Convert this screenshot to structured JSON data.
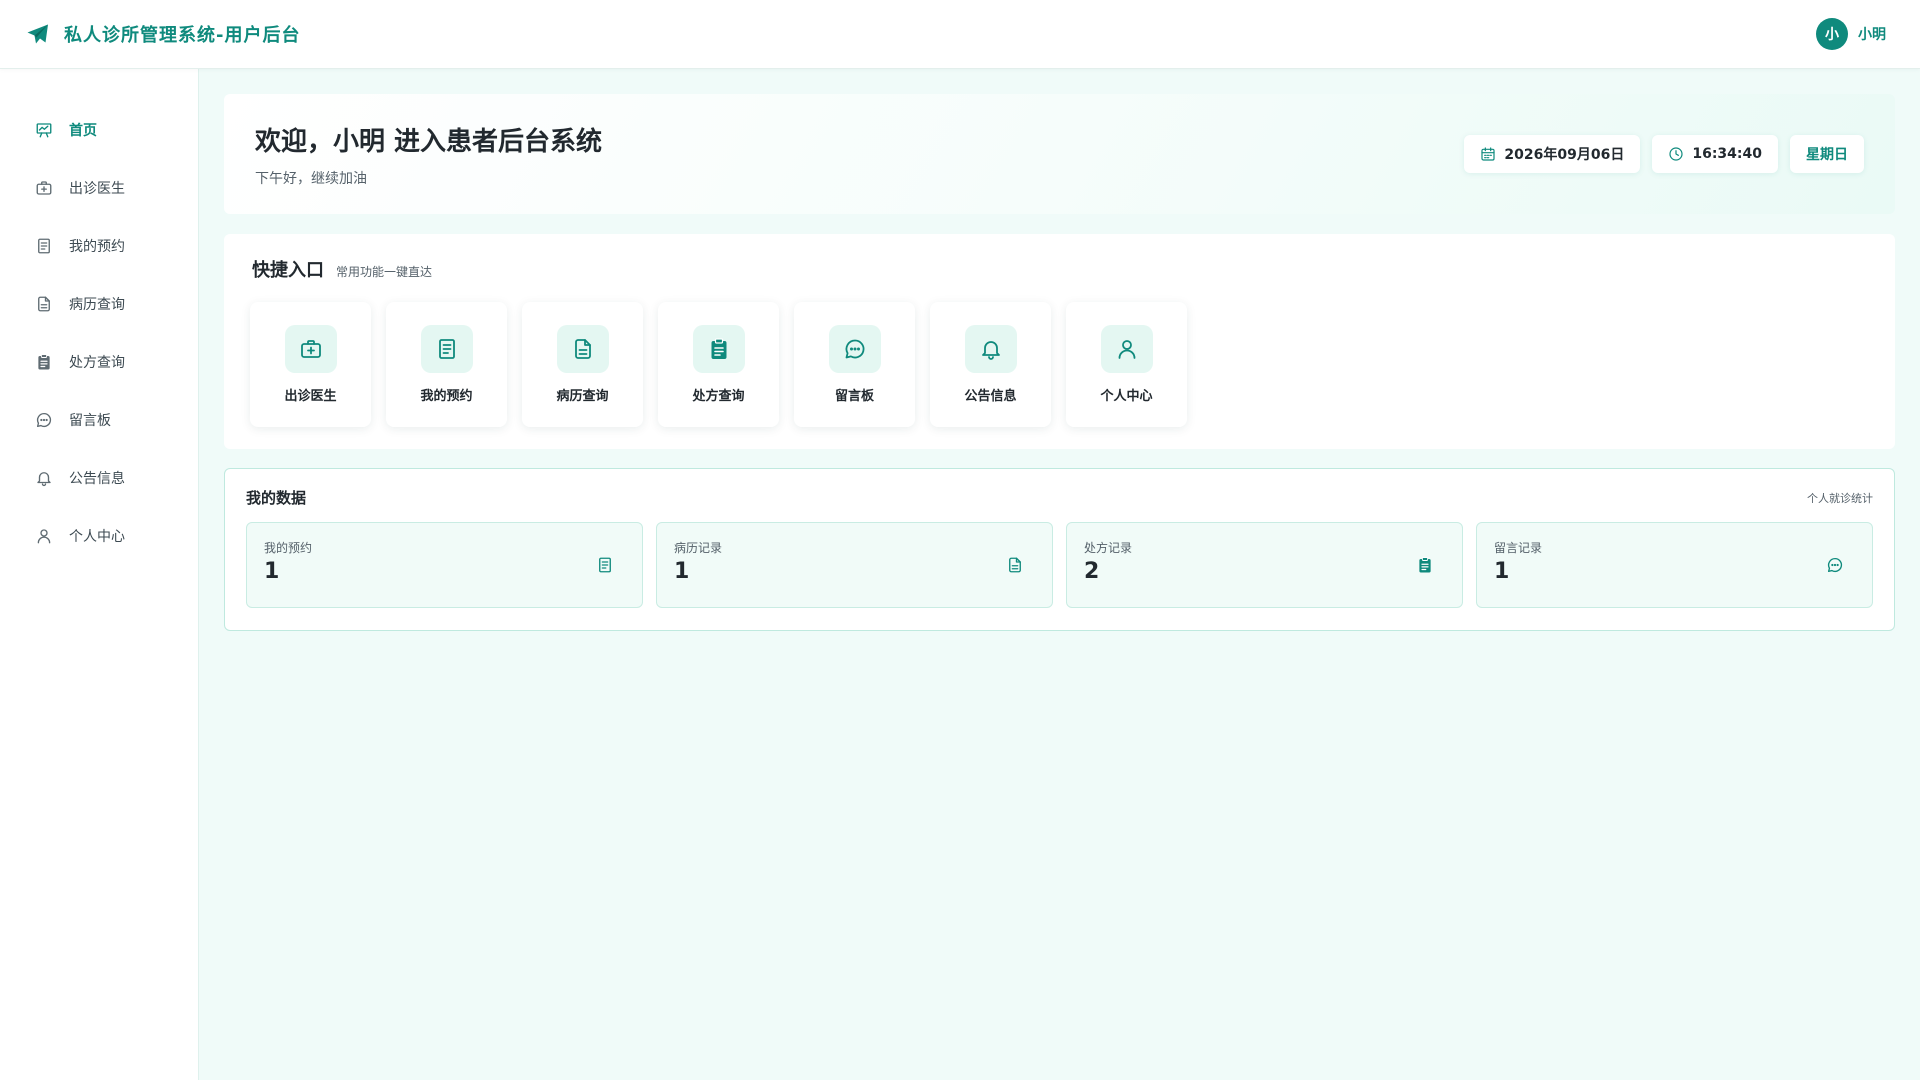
{
  "header": {
    "title": "私人诊所管理系统-用户后台",
    "logo_icon": "paper-plane-icon",
    "user": {
      "avatar_text": "小",
      "name": "小明"
    }
  },
  "sidebar": {
    "items": [
      {
        "label": "首页",
        "icon": "chart-board-icon",
        "active": true
      },
      {
        "label": "出诊医生",
        "icon": "medical-kit-icon"
      },
      {
        "label": "我的预约",
        "icon": "document-list-icon"
      },
      {
        "label": "病历查询",
        "icon": "file-text-icon"
      },
      {
        "label": "处方查询",
        "icon": "clipboard-icon"
      },
      {
        "label": "留言板",
        "icon": "chat-bubble-icon"
      },
      {
        "label": "公告信息",
        "icon": "bell-icon"
      },
      {
        "label": "个人中心",
        "icon": "user-icon"
      }
    ]
  },
  "welcome": {
    "title": "欢迎，小明 进入患者后台系统",
    "subtitle": "下午好，继续加油",
    "date": "2026年09月06日",
    "time": "16:34:40",
    "weekday": "星期日"
  },
  "quick": {
    "title": "快捷入口",
    "subtitle": "常用功能一键直达",
    "items": [
      {
        "label": "出诊医生",
        "icon": "medical-kit-icon"
      },
      {
        "label": "我的预约",
        "icon": "document-list-icon"
      },
      {
        "label": "病历查询",
        "icon": "file-text-icon"
      },
      {
        "label": "处方查询",
        "icon": "clipboard-icon"
      },
      {
        "label": "留言板",
        "icon": "chat-bubble-icon"
      },
      {
        "label": "公告信息",
        "icon": "bell-icon"
      },
      {
        "label": "个人中心",
        "icon": "user-icon"
      }
    ]
  },
  "mydata": {
    "title": "我的数据",
    "subtitle": "个人就诊统计",
    "stats": [
      {
        "label": "我的预约",
        "value": "1",
        "icon": "document-list-icon"
      },
      {
        "label": "病历记录",
        "value": "1",
        "icon": "file-text-icon"
      },
      {
        "label": "处方记录",
        "value": "2",
        "icon": "clipboard-icon"
      },
      {
        "label": "留言记录",
        "value": "1",
        "icon": "chat-bubble-icon"
      }
    ]
  },
  "colors": {
    "accent": "#0f8a7d",
    "background": "#f0fbf9",
    "tint": "#e4f7f2"
  }
}
